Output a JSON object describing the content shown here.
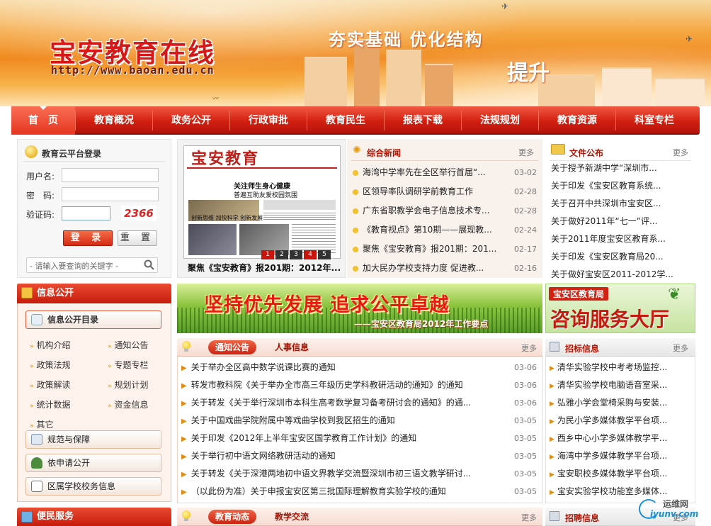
{
  "header": {
    "site_title": "宝安教育在线",
    "site_url": "http://www.baoan.edu.cn",
    "slogan": "夯实基础  优化结构",
    "slogan2": "提升"
  },
  "nav": {
    "items": [
      "首　页",
      "教育概况",
      "政务公开",
      "行政审批",
      "教育民生",
      "报表下载",
      "法规规划",
      "教育资源",
      "科室专栏"
    ]
  },
  "login": {
    "title": "教育云平台登录",
    "username_label": "用户名:",
    "password_label": "密　码:",
    "captcha_label": "验证码:",
    "captcha_code": "2366",
    "login_button": "登 录",
    "reset_button": "重 置",
    "search_placeholder": "- 请输入要查询的关键字 -"
  },
  "newspaper": {
    "masthead": "宝安教育",
    "headline1": "关注师生身心健康",
    "headline2": "普遍互助友爱校园氛围",
    "headline3": "创新思维  加快科学  创新发展",
    "caption": "聚焦《宝安教育》报201期：2012年...",
    "pages": [
      "1",
      "2",
      "3",
      "4",
      "5"
    ],
    "active_page": "4"
  },
  "news": {
    "title": "综合新闻",
    "more": "更多",
    "items": [
      {
        "title": "海湾中学率先在全区举行首届“...",
        "date": "03-02"
      },
      {
        "title": "区领导率队调研学前教育工作",
        "date": "02-28"
      },
      {
        "title": "广东省职教学会电子信息技术专...",
        "date": "02-28"
      },
      {
        "title": "《教育视点》第10期——展现教...",
        "date": "02-24"
      },
      {
        "title": "聚焦《宝安教育》报201期：201...",
        "date": "02-17"
      },
      {
        "title": "加大民办学校支持力度 促进教...",
        "date": "02-16"
      }
    ]
  },
  "files": {
    "title": "文件公布",
    "more": "更多",
    "items": [
      "关于授予新湖中学“深圳市...",
      "关于印发《宝安区教育系统...",
      "关于召开中共深圳市宝安区...",
      "关于做好2011年“七一”评...",
      "关于2011年度宝安区教育系...",
      "关于印发《宝安区教育局20...",
      "关于做好宝安区2011-2012学..."
    ]
  },
  "info_open": {
    "title": "信息公开",
    "catalog": "信息公开目录",
    "links": [
      [
        "机构介绍",
        "通知公告"
      ],
      [
        "政策法规",
        "专题专栏"
      ],
      [
        "政策解读",
        "规划计划"
      ],
      [
        "统计数据",
        "资金信息"
      ],
      [
        "其它",
        ""
      ]
    ],
    "buttons": [
      "规范与保障",
      "依申请公开",
      "区属学校校务信息"
    ]
  },
  "convenience": {
    "title": "便民服务"
  },
  "banner": {
    "main_text": "坚持优先发展  追求公平卓越",
    "sub_text": "——宝安区教育局2012年工作要点",
    "side_top": "宝安区教育局",
    "side_main": "咨询服务大厅"
  },
  "notices": {
    "tab_active": "通知公告",
    "tab_other": "人事信息",
    "more": "更多",
    "items": [
      {
        "title": "关于举办全区高中数学说课比赛的通知",
        "date": "03-06"
      },
      {
        "title": "转发市教科院《关于举办全市高三年级历史学科教研活动的通知》的通知",
        "date": "03-06"
      },
      {
        "title": "关于转发《关于举行深圳市本科生高考数学复习备考研讨会的通知》的通...",
        "date": "03-06"
      },
      {
        "title": "关于中国戏曲学院附属中等戏曲学校到我区招生的通知",
        "date": "03-05"
      },
      {
        "title": "关于印发《2012年上半年宝安区国学教育工作计划》的通知",
        "date": "03-05"
      },
      {
        "title": "关于举行初中语文网络教研活动的通知",
        "date": "03-05"
      },
      {
        "title": "关于转发《关于深港两地初中语文界教学交流暨深圳市初三语文教学研讨...",
        "date": "03-05"
      },
      {
        "title": "（以此份为准）关于申报宝安区第三批国际理解教育实验学校的通知",
        "date": "03-05"
      }
    ]
  },
  "bids": {
    "title": "招标信息",
    "more": "更多",
    "items": [
      "清华实验学校中考考场监控...",
      "清华实验学校电脑语音室采...",
      "弘雅小学会堂椅采购与安装...",
      "为民小学多媒体教学平台项...",
      "西乡中心小学多媒体教学平...",
      "海湾中学多媒体教学平台项...",
      "宝安职校多媒体教学平台项...",
      "宝安实验学校功能室多媒体..."
    ]
  },
  "edu_news": {
    "tab_active": "教育动态",
    "tab_other": "教学交流",
    "more": "更多"
  },
  "recruit": {
    "title": "招聘信息",
    "more": "更多"
  },
  "watermark": {
    "text": "运维网",
    "domain": "iyunv.com"
  },
  "colors": {
    "brand_red": "#d31f10",
    "accent_orange": "#f08a1f",
    "text_dark": "#222222"
  }
}
